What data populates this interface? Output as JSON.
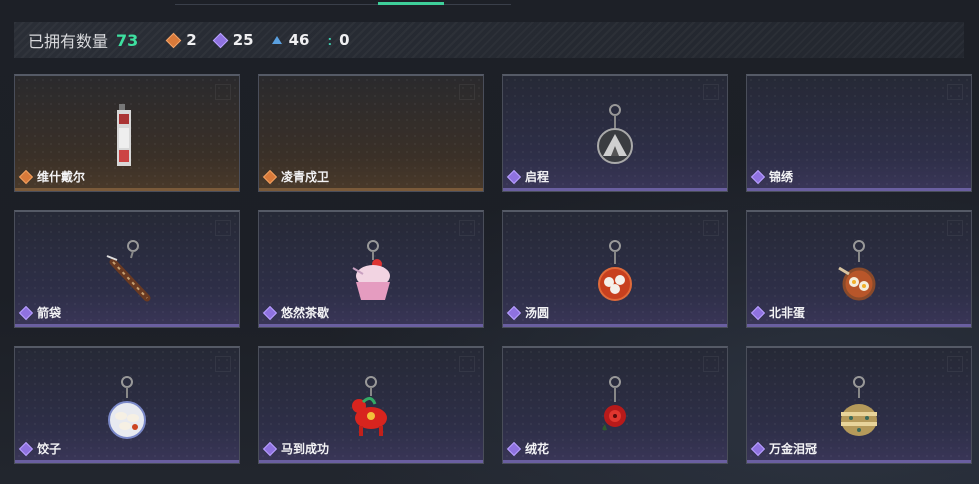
{
  "header": {
    "faded_title": "",
    "total_label": "已拥有数量",
    "total_value": "73"
  },
  "stats": [
    {
      "icon": "orange-diamond-icon",
      "color": "#d97a3a",
      "value": "2"
    },
    {
      "icon": "purple-diamond-icon",
      "color": "#8f72e0",
      "value": "25"
    },
    {
      "icon": "blue-triangle-icon",
      "color": "#5aa0e0",
      "value": "46"
    },
    {
      "icon": "teal-colon-icon",
      "color": "#3ecfb0",
      "value": "0"
    }
  ],
  "items": [
    {
      "name": "维什戴尔",
      "rarity": "orange",
      "icon": "banner-charm-icon"
    },
    {
      "name": "凌青戍卫",
      "rarity": "orange",
      "icon": ""
    },
    {
      "name": "启程",
      "rarity": "purple",
      "icon": "mountain-medallion-charm-icon"
    },
    {
      "name": "锦绣",
      "rarity": "purple",
      "icon": ""
    },
    {
      "name": "箭袋",
      "rarity": "purple",
      "icon": "quiver-charm-icon"
    },
    {
      "name": "悠然茶歇",
      "rarity": "purple",
      "icon": "cupcake-charm-icon"
    },
    {
      "name": "汤圆",
      "rarity": "purple",
      "icon": "tangyuan-bowl-charm-icon"
    },
    {
      "name": "北非蛋",
      "rarity": "purple",
      "icon": "shakshuka-pan-charm-icon"
    },
    {
      "name": "饺子",
      "rarity": "purple",
      "icon": "dumpling-plate-charm-icon"
    },
    {
      "name": "马到成功",
      "rarity": "purple",
      "icon": "red-horse-charm-icon"
    },
    {
      "name": "绒花",
      "rarity": "purple",
      "icon": "red-flower-charm-icon"
    },
    {
      "name": "万金泪冠",
      "rarity": "purple",
      "icon": "gold-crown-charm-icon"
    }
  ]
}
